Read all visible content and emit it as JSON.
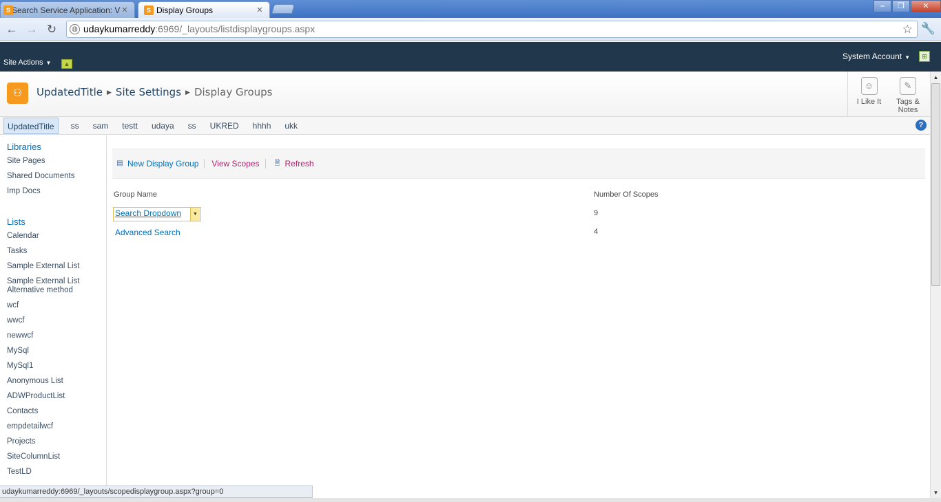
{
  "browser": {
    "tabs": [
      {
        "title": "Search Service Application: Vi",
        "active": false
      },
      {
        "title": "Display Groups",
        "active": true
      }
    ],
    "window_buttons": [
      "minimize",
      "maximize",
      "close"
    ],
    "url_host": "udaykumarreddy",
    "url_path": ":6969/_layouts/listdisplaygroups.aspx",
    "status_url": "udaykumarreddy:6969/_layouts/scopedisplaygroup.aspx?group=0"
  },
  "ribbon": {
    "site_actions": "Site Actions",
    "account": "System Account"
  },
  "title_area": {
    "breadcrumb": [
      "UpdatedTitle",
      "Site Settings",
      "Display Groups"
    ],
    "like_label": "I Like It",
    "tags_label_1": "Tags &",
    "tags_label_2": "Notes"
  },
  "top_nav": [
    "UpdatedTitle",
    "ss",
    "sam",
    "testt",
    "udaya",
    "ss",
    "UKRED",
    "hhhh",
    "ukk"
  ],
  "quick_launch": {
    "libraries_heading": "Libraries",
    "libraries": [
      "Site Pages",
      "Shared Documents",
      "Imp Docs"
    ],
    "lists_heading": "Lists",
    "lists": [
      "Calendar",
      "Tasks",
      "Sample External List",
      "Sample External List Alternative method",
      "wcf",
      "wwcf",
      "newwcf",
      "MySql",
      "MySql1",
      "Anonymous List",
      "ADWProductList",
      "Contacts",
      "empdetailwcf",
      "Projects",
      "SiteColumnList",
      "TestLD"
    ]
  },
  "actions": {
    "new_group": "New Display Group",
    "view_scopes": "View Scopes",
    "refresh": "Refresh"
  },
  "table": {
    "col_name": "Group Name",
    "col_scopes": "Number Of Scopes",
    "rows": [
      {
        "name": "Search Dropdown",
        "scopes": "9"
      },
      {
        "name": "Advanced Search",
        "scopes": "4"
      }
    ]
  },
  "colors": {
    "ribbon_bg": "#21374c",
    "link": "#0072bc",
    "accent_magenta": "#b0246d",
    "site_logo": "#f69a1f"
  }
}
